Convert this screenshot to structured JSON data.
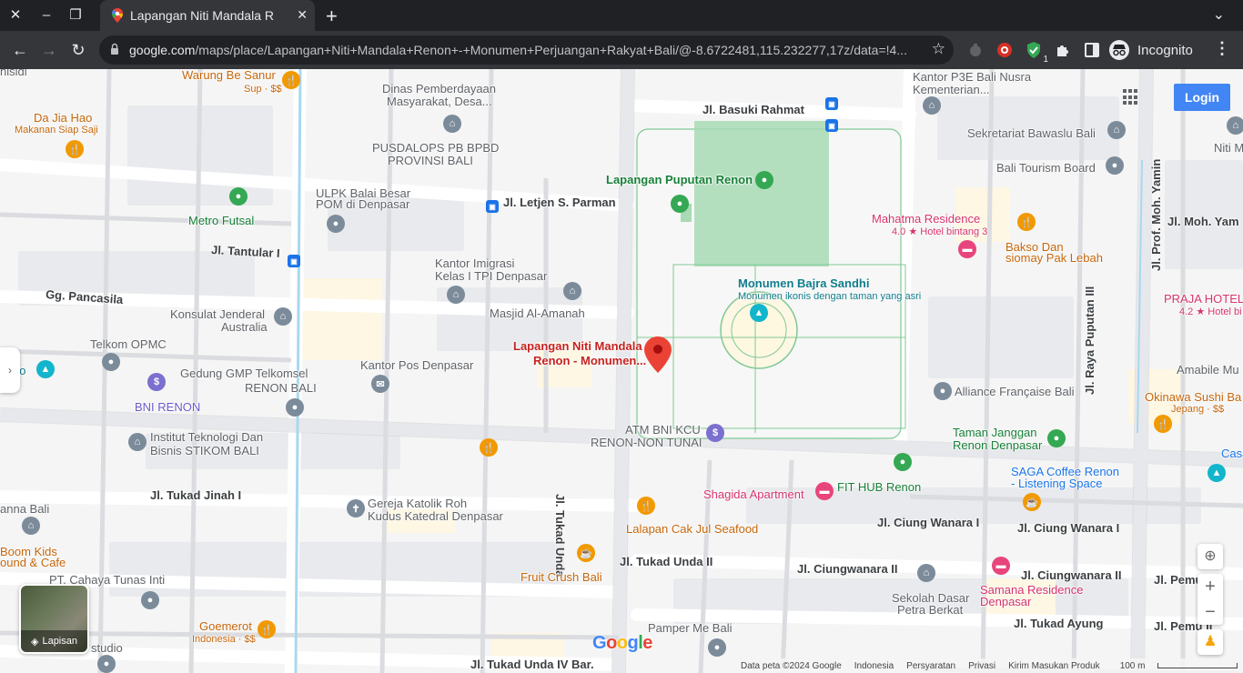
{
  "browser": {
    "tab_title": "Lapangan Niti Mandala R",
    "url_host": "google.com",
    "url_path": "/maps/place/Lapangan+Niti+Mandala+Renon+-+Monumen+Perjuangan+Rakyat+Bali/@-8.6722481,115.232277,17z/data=!4...",
    "incognito_label": "Incognito",
    "extension_badge": "1"
  },
  "map": {
    "login_label": "Login",
    "layers_label": "Lapisan",
    "copyright": "Data peta ©2024 Google",
    "footer_links": [
      "Indonesia",
      "Persyaratan",
      "Privasi",
      "Kirim Masukan Produk"
    ],
    "scale": "100 m",
    "google_logo": "Google",
    "selected_place": "Lapangan Niti Mandala Renon - Monumen...",
    "selected_place_line1": "Lapangan Niti Mandala",
    "selected_place_line2": "Renon - Monumen...",
    "roads": {
      "basuki": "Jl. Basuki Rahmat",
      "parman": "Jl. Letjen S. Parman",
      "tantular": "Jl. Tantular I",
      "pancasila": "Gg. Pancasila",
      "tukad_jinah": "Jl. Tukad Jinah I",
      "tukad_unda": "Jl. Tukad Unda",
      "tukad_unda_ii": "Jl. Tukad Unda II",
      "tukad_unda_iv": "Jl. Tukad Unda IV Bar.",
      "ciung_wanara": "Jl. Ciung Wanara I",
      "ciung_wanara_2": "Jl. Ciung Wanara I",
      "ciungwanara_ii": "Jl. Ciungwanara II",
      "ciungwanara_ii_2": "Jl. Ciungwanara II",
      "tukad_ayung": "Jl. Tukad Ayung",
      "puputan_iii": "Jl. Raya Puputan III",
      "moh_yamin": "Jl. Prof. Moh. Yamin",
      "moh_yam": "Jl. Moh. Yam",
      "pemu": "Jl. Pemu",
      "pemu_ii": "Jl. Pemu II"
    },
    "places": {
      "warung_be_sanur": "Warung Be Sanur",
      "warung_sub": "Sup · $$",
      "da_jia_hao": "Da Jia Hao",
      "da_jia_hao_sub": "Makanan Siap Saji",
      "dinas_1": "Dinas Pemberdayaan",
      "dinas_2": "Masyarakat, Desa...",
      "pusdalops_1": "PUSDALOPS PB BPBD",
      "pusdalops_2": "PROVINSI BALI",
      "ulpk_1": "ULPK Balai Besar",
      "ulpk_2": "POM di Denpasar",
      "metro_futsal": "Metro Futsal",
      "lap_puputan": "Lapangan Puputan Renon",
      "kantor_p3e_1": "Kantor P3E Bali Nusra",
      "kantor_p3e_2": "Kementerian...",
      "bawaslu": "Sekretariat Bawaslu Bali",
      "tourism": "Bali Tourism Board",
      "mahatma": "Mahatma Residence",
      "mahatma_sub": "4.0 ★ Hotel bintang 3",
      "bakso_1": "Bakso Dan",
      "bakso_2": "siomay Pak Lebah",
      "praja": "PRAJA HOTEL",
      "praja_sub": "4.2 ★ Hotel bi",
      "imigrasi_1": "Kantor Imigrasi",
      "imigrasi_2": "Kelas I TPI Denpasar",
      "bajra": "Monumen Bajra Sandhi",
      "bajra_sub": "Monumen ikonis dengan taman yang asri",
      "konsulat_1": "Konsulat Jenderal",
      "konsulat_2": "Australia",
      "masjid": "Masjid Al-Amanah",
      "telkom": "Telkom OPMC",
      "gmp_1": "Gedung GMP Telkomsel",
      "gmp_2": "RENON BALI",
      "kantor_pos": "Kantor Pos Denpasar",
      "bni": "BNI RENON",
      "atm_1": "ATM BNI KCU",
      "atm_2": "RENON-NON TUNAI",
      "alliance": "Alliance Française Bali",
      "okinawa": "Okinawa Sushi Ba",
      "okinawa_sub": "Jepang · $$",
      "amabile": "Amabile Mu",
      "stikom_1": "Institut Teknologi Dan",
      "stikom_2": "Bisnis STIKOM BALI",
      "taman_1": "Taman Janggan",
      "taman_2": "Renon Denpasar",
      "casa": "Casa Bu",
      "saga_1": "SAGA Coffee Renon",
      "saga_2": "- Listening Space",
      "shagida": "Shagida Apartment",
      "fithub": "FIT HUB Renon",
      "gereja_1": "Gereja Katolik Roh",
      "gereja_2": "Kudus Katedral Denpasar",
      "lalapan": "Lalapan Cak Jul Seafood",
      "anna": "anna Bali",
      "boom_1": "Boom Kids",
      "boom_2": "ound & Cafe",
      "fruit": "Fruit Crush Bali",
      "cahaya": "PT. Cahaya Tunas Inti",
      "sekolah_1": "Sekolah Dasar",
      "sekolah_2": "Petra Berkat",
      "samana_1": "Samana Residence",
      "samana_2": "Denpasar",
      "goemerot": "Goemerot",
      "goemerot_sub": "Indonesia · $$",
      "pamper": "Pamper Me Bali",
      "studio": "studio",
      "nisidi": "nisidi",
      "niti": "Niti M",
      "ho": "ho"
    }
  }
}
